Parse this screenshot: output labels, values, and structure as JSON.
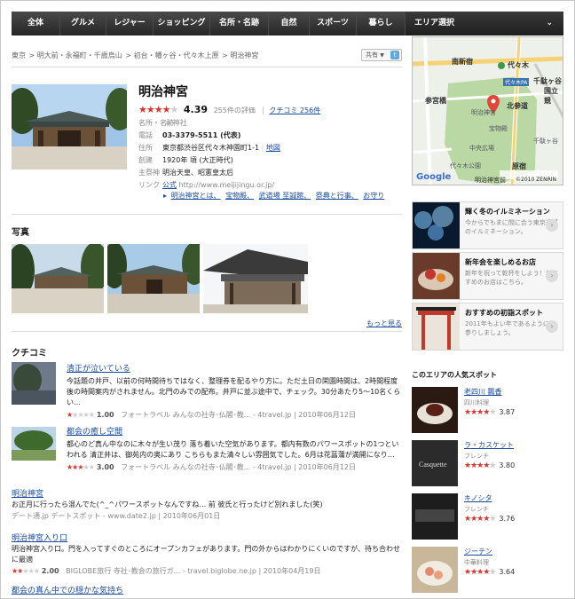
{
  "nav": {
    "items": [
      "全体",
      "グルメ",
      "レジャー",
      "ショッピング",
      "名所・名跡",
      "自然",
      "スポーツ",
      "暮らし"
    ],
    "area": "エリア選択"
  },
  "breadcrumb": [
    "東京",
    "明大前・永福町・千歳烏山",
    "初台・幡ヶ谷・代々木上原",
    "明治神宮"
  ],
  "share": "共有",
  "spot": {
    "title": "明治神宮",
    "rating_stars": "★★★★",
    "rating_off": "★",
    "score": "4.39",
    "review_count": "255件の評価",
    "kuchikomi": "クチコミ 256件",
    "category_label": "名所・名跡",
    "category": "神社",
    "phone_label": "電話",
    "phone": "03-3379-5511 (代表)",
    "address_label": "住所",
    "address": "東京都渋谷区代々木神園町1-1",
    "map_link": "地図",
    "founded_label": "創建",
    "founded": "1920年 頃 (大正時代)",
    "deity_label": "主祭神",
    "deity": "明治天皇、昭憲皇太后",
    "link_label": "リンク",
    "official": "公式",
    "url": "http://www.meijijingu.or.jp/",
    "subsections": [
      "明治神宮とは、",
      "宝物殿、",
      "武道場 至誠館、",
      "祭典と行事、",
      "お守り"
    ]
  },
  "photos": {
    "heading": "写真",
    "more": "もっと見る"
  },
  "reviews": {
    "heading": "クチコミ",
    "items": [
      {
        "title": "清正が泣いている",
        "body": "今話題の井戸、以前の何時間待ちではなく、整理券を配るやり方に。ただ土日の閑園時間は、2時間程度後の時間案内がされません。北門のみでの配布。井戸に並ぶ途中で、チェック。30分あたり5～10名くらい…",
        "stars": "★",
        "stars_off": "★★★★",
        "score": "1.00",
        "source": "フォートラベル みんなの社寺･仏閣･教... - 4travel.jp",
        "date": "2010年06月12日"
      },
      {
        "title": "都会の癒し空間",
        "body": "都心のど真ん中なのに木々が生い茂り 落ち着いた空気があります。都内有数のパワースポットの1つといわれる 清正井は、御苑内の奥にあり こちらもまた清々しい雰囲気でした。6月は花菖蒲が満開になり…",
        "stars": "★★★",
        "stars_off": "★★",
        "score": "3.00",
        "source": "フォートラベル みんなの社寺･仏閣･教... - 4travel.jp",
        "date": "2010年06月12日"
      },
      {
        "title": "明治神宮",
        "body": "お正月に行ったら混んでた(^_^パワースポットなんですね… 前 彼氏と行ったけど別れました(笑)",
        "source": "デート通.jp デートスポット - www.date2.jp",
        "date": "2010年06月01日"
      },
      {
        "title": "明治神宮入り口",
        "body": "明治神宮入り口。門を入ってすぐのところにオープンカフェがあります。門の外からはわかりにくいのですが、待ち合わせに最適",
        "stars": "★★",
        "stars_off": "★★★",
        "score": "2.00",
        "source": "BIGLOBE旅行 寺社･教会の旅行ガ... - travel.biglobe.ne.jp",
        "date": "2010年04月19日"
      },
      {
        "title": "都会の真ん中での穏かな気持ち"
      }
    ]
  },
  "map": {
    "labels": [
      "南新宿",
      "代々木",
      "千駄ヶ谷",
      "国立競",
      "代々木PA",
      "参宮橋",
      "北参道",
      "中央広場",
      "宝物殿",
      "明治神宮",
      "原宿",
      "明治神宮前",
      "千駄ヶ谷",
      "代々木公園"
    ],
    "copyright": "©2010 ZENRIN",
    "logo": "Google"
  },
  "promos": [
    {
      "title": "輝く冬のイルミネーション",
      "desc": "今からでもまに間に合う東京近郊のイルミネーション。"
    },
    {
      "title": "新年会を楽しめるお店",
      "desc": "新年を祝って乾杯をしよう！おすすめのお店はこちら。"
    },
    {
      "title": "おすすめの初詣スポット",
      "desc": "2011年もよい年であるようにお参りしましょう。"
    }
  ],
  "popular": {
    "heading": "このエリアの人気スポット",
    "items": [
      {
        "name": "老四川 飄香",
        "category": "四川料理",
        "stars": "★★★★",
        "stars_off": "★",
        "score": "3.87"
      },
      {
        "name": "ラ・カスケット",
        "category": "フレンチ",
        "stars": "★★★★",
        "stars_off": "★",
        "score": "3.80"
      },
      {
        "name": "キノシタ",
        "category": "フレンチ",
        "stars": "★★★★",
        "stars_off": "★",
        "score": "3.76"
      },
      {
        "name": "ジーテン",
        "category": "中華料理",
        "stars": "★★★★",
        "stars_off": "★",
        "score": "3.64"
      }
    ]
  }
}
